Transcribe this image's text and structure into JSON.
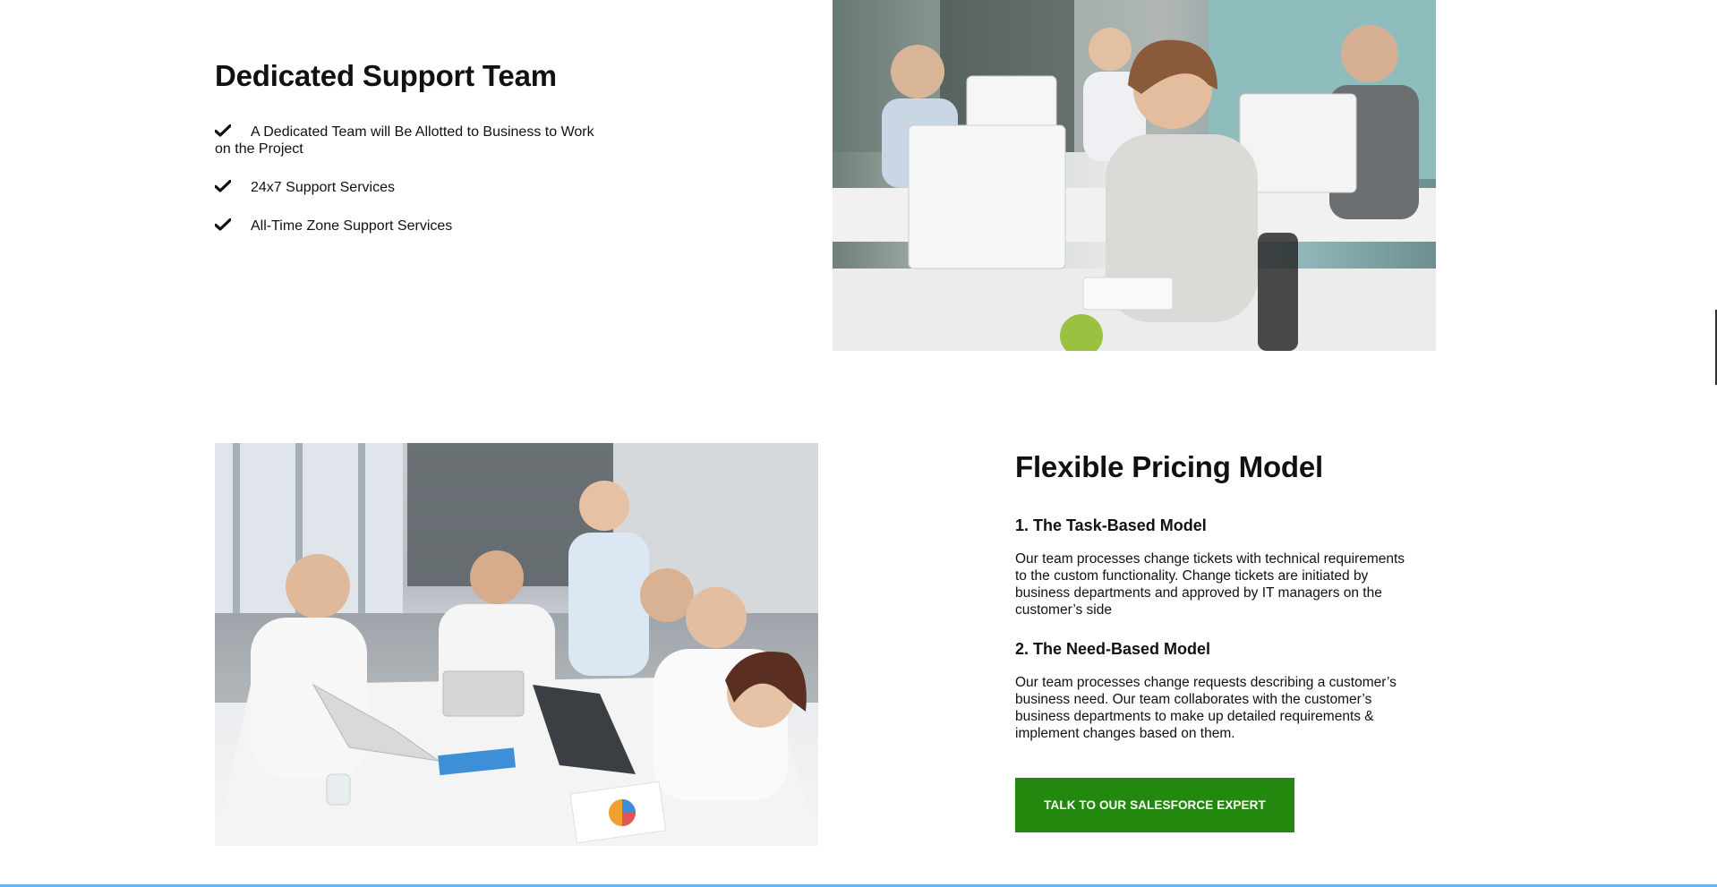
{
  "support": {
    "title": "Dedicated Support Team",
    "items": [
      "A Dedicated Team will Be Allotted to Business to Work on the Project",
      "24x7 Support Services",
      "All-Time Zone Support Services"
    ],
    "icon": "check-icon"
  },
  "pricing": {
    "title": "Flexible Pricing Model",
    "models": [
      {
        "heading": "1. The Task-Based Model",
        "description": "Our team processes change tickets with technical requirements to the custom functionality. Change tickets are initiated by business departments and approved by IT managers on the customer’s side"
      },
      {
        "heading": "2. The Need-Based Model",
        "description": "Our team processes change requests describing a customer’s business need. Our team collaborates with the customer’s business departments to make up detailed requirements & implement changes based on them."
      }
    ],
    "cta_label": "TALK TO OUR SALESFORCE EXPERT"
  },
  "colors": {
    "cta_background": "#23890e",
    "bottom_border": "#5cb8ef"
  }
}
